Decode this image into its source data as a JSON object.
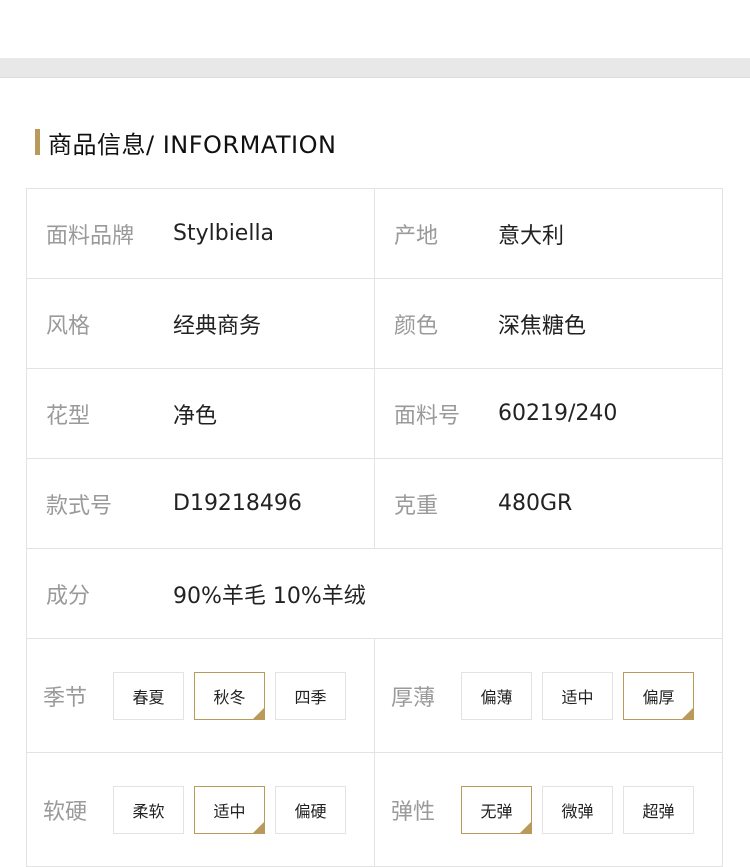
{
  "section": {
    "title": "商品信息/ INFORMATION"
  },
  "colors": {
    "accent": "#b99a5a",
    "label": "#9a9a9a",
    "border": "#e3e3e3"
  },
  "rows": [
    {
      "left": {
        "label": "面料品牌",
        "value": "Stylbiella"
      },
      "right": {
        "label": "产地",
        "value": "意大利"
      }
    },
    {
      "left": {
        "label": "风格",
        "value": "经典商务"
      },
      "right": {
        "label": "颜色",
        "value": "深焦糖色"
      }
    },
    {
      "left": {
        "label": "花型",
        "value": "净色"
      },
      "right": {
        "label": "面料号",
        "value": "60219/240"
      }
    },
    {
      "left": {
        "label": "款式号",
        "value": "D19218496"
      },
      "right": {
        "label": "克重",
        "value": "480GR"
      }
    }
  ],
  "composition": {
    "label": "成分",
    "value": "90%羊毛 10%羊绒"
  },
  "season": {
    "label": "季节",
    "options": [
      "春夏",
      "秋冬",
      "四季"
    ],
    "selected": "秋冬"
  },
  "thickness": {
    "label": "厚薄",
    "options": [
      "偏薄",
      "适中",
      "偏厚"
    ],
    "selected": "偏厚"
  },
  "softness": {
    "label": "软硬",
    "options": [
      "柔软",
      "适中",
      "偏硬"
    ],
    "selected": "适中"
  },
  "elasticity": {
    "label": "弹性",
    "options": [
      "无弹",
      "微弹",
      "超弹"
    ],
    "selected": "无弹"
  }
}
